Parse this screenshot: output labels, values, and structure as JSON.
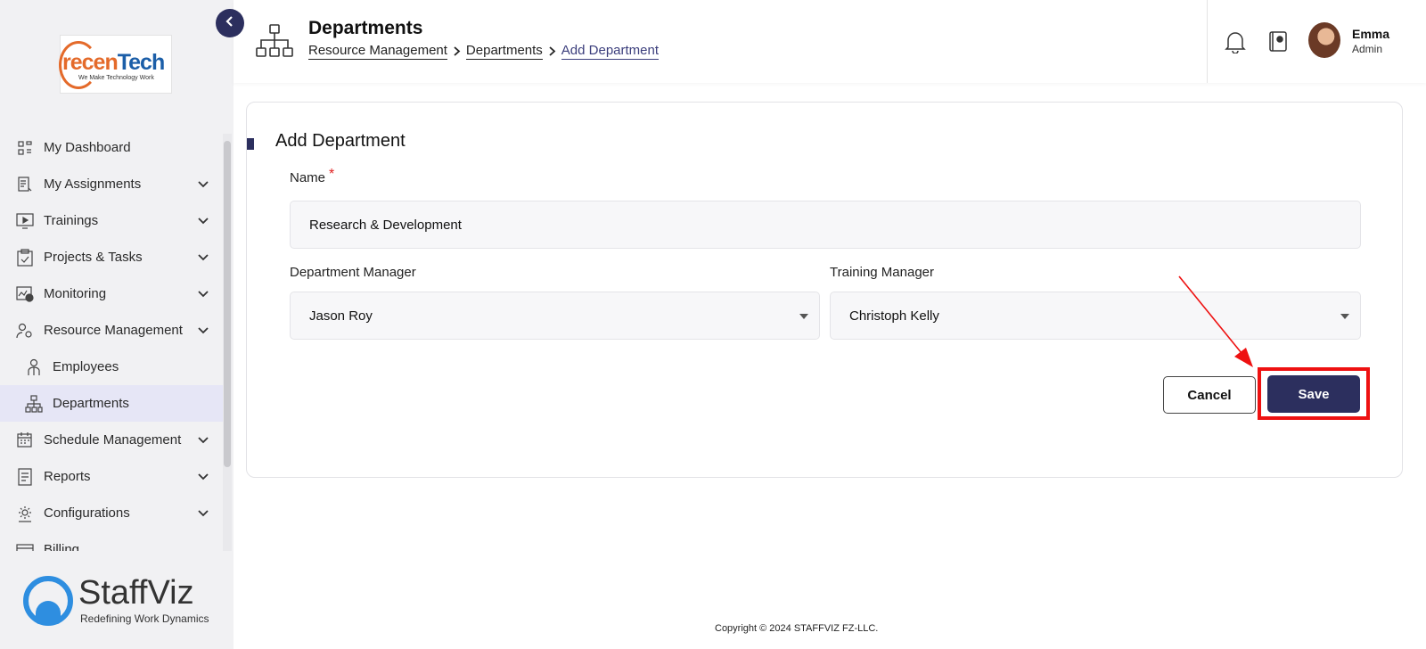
{
  "brand": {
    "logo_prefix": "recen",
    "logo_suffix": "Tech",
    "logo_tagline": "We Make Technology Work",
    "footer_brand": "StaffViz",
    "footer_tagline": "Redefining Work Dynamics"
  },
  "sidebar": {
    "items": [
      {
        "label": "My Dashboard",
        "icon": "dashboard-icon"
      },
      {
        "label": "My Assignments",
        "icon": "assignments-icon"
      },
      {
        "label": "Trainings",
        "icon": "trainings-icon"
      },
      {
        "label": "Projects & Tasks",
        "icon": "clipboard-icon"
      },
      {
        "label": "Monitoring",
        "icon": "monitoring-icon"
      },
      {
        "label": "Resource Management",
        "icon": "user-gear-icon"
      },
      {
        "label": "Employees",
        "icon": "employee-icon"
      },
      {
        "label": "Departments",
        "icon": "org-chart-icon"
      },
      {
        "label": "Schedule Management",
        "icon": "calendar-icon"
      },
      {
        "label": "Reports",
        "icon": "report-icon"
      },
      {
        "label": "Configurations",
        "icon": "config-icon"
      },
      {
        "label": "Billing",
        "icon": "billing-icon"
      }
    ],
    "active": "Departments"
  },
  "header": {
    "title": "Departments",
    "breadcrumb": [
      "Resource Management",
      "Departments",
      "Add Department"
    ],
    "user_name": "Emma",
    "user_role": "Admin"
  },
  "form": {
    "title": "Add Department",
    "name_label": "Name",
    "required_mark": "*",
    "name_value": "Research & Development",
    "dept_manager_label": "Department Manager",
    "dept_manager_value": "Jason Roy",
    "training_manager_label": "Training Manager",
    "training_manager_value": "Christoph Kelly",
    "cancel_label": "Cancel",
    "save_label": "Save"
  },
  "footer": {
    "copyright": "Copyright © 2024 STAFFVIZ FZ-LLC."
  },
  "colors": {
    "primary": "#2c2f5e",
    "highlight": "#ee1111",
    "active_bg": "#e6e6f6"
  }
}
